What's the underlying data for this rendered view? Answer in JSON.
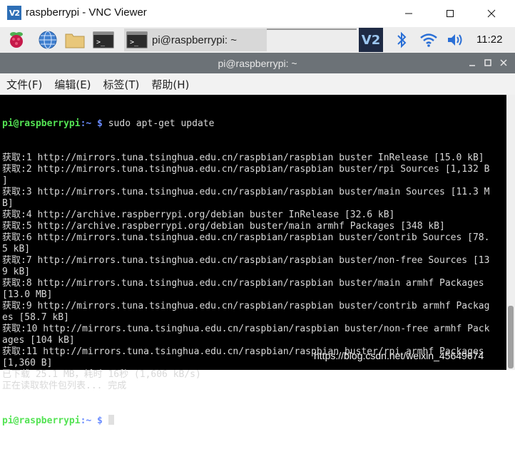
{
  "window": {
    "logo_text": "V2",
    "title": "raspberrypi - VNC Viewer"
  },
  "panel": {
    "launcher_icons": [
      "raspberry-icon",
      "globe-icon",
      "folder-icon",
      "terminal-icon"
    ],
    "task_label": "pi@raspberrypi: ~",
    "tray_vnc_text": "V2",
    "clock": "11:22"
  },
  "terminal": {
    "title": "pi@raspberrypi: ~",
    "menu": [
      "文件(F)",
      "编辑(E)",
      "标签(T)",
      "帮助(H)"
    ],
    "prompt_user": "pi@raspberrypi",
    "prompt_sep": ":",
    "prompt_path": "~ $",
    "command": " sudo apt-get update",
    "output": [
      "获取:1 http://mirrors.tuna.tsinghua.edu.cn/raspbian/raspbian buster InRelease [15.0 kB]",
      "获取:2 http://mirrors.tuna.tsinghua.edu.cn/raspbian/raspbian buster/rpi Sources [1,132 B",
      "]",
      "获取:3 http://mirrors.tuna.tsinghua.edu.cn/raspbian/raspbian buster/main Sources [11.3 M",
      "B]",
      "获取:4 http://archive.raspberrypi.org/debian buster InRelease [32.6 kB]",
      "获取:5 http://archive.raspberrypi.org/debian buster/main armhf Packages [348 kB]",
      "获取:6 http://mirrors.tuna.tsinghua.edu.cn/raspbian/raspbian buster/contrib Sources [78.",
      "5 kB]",
      "获取:7 http://mirrors.tuna.tsinghua.edu.cn/raspbian/raspbian buster/non-free Sources [13",
      "9 kB]",
      "获取:8 http://mirrors.tuna.tsinghua.edu.cn/raspbian/raspbian buster/main armhf Packages",
      "[13.0 MB]",
      "获取:9 http://mirrors.tuna.tsinghua.edu.cn/raspbian/raspbian buster/contrib armhf Packag",
      "es [58.7 kB]",
      "获取:10 http://mirrors.tuna.tsinghua.edu.cn/raspbian/raspbian buster/non-free armhf Pack",
      "ages [104 kB]",
      "获取:11 http://mirrors.tuna.tsinghua.edu.cn/raspbian/raspbian buster/rpi armhf Packages",
      "[1,360 B]",
      "已下载 25.1 MB，耗时 16秒 (1,606 kB/s)",
      "正在读取软件包列表... 完成"
    ]
  },
  "watermark": "https://blog.csdn.net/weixin_45649674"
}
